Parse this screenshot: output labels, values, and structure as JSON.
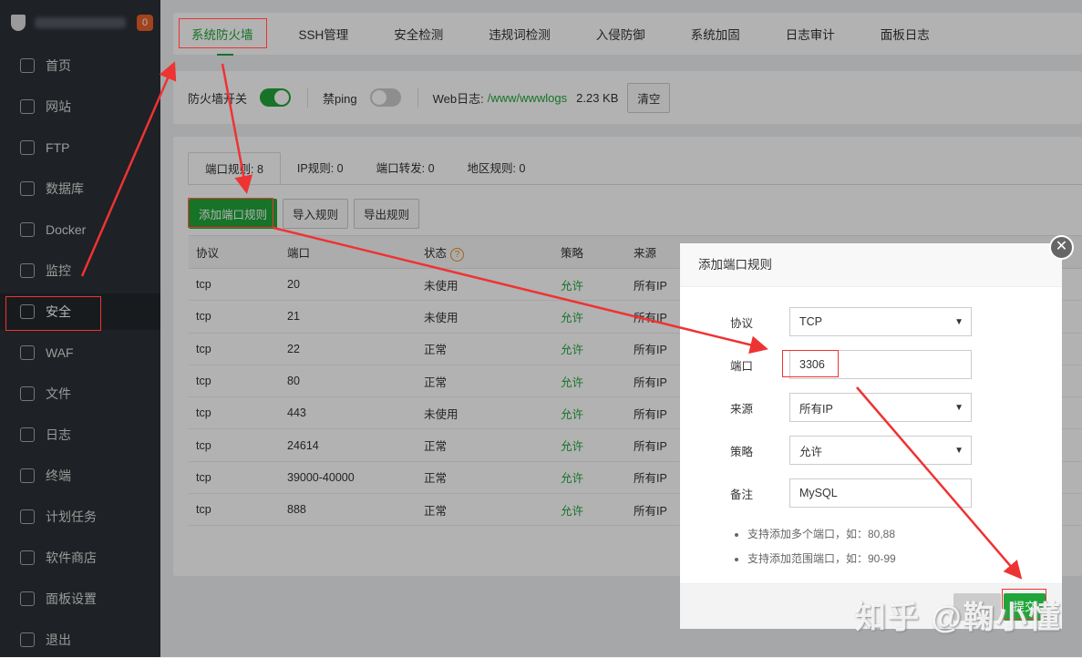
{
  "sidebar": {
    "badge": "0",
    "items": [
      {
        "label": "首页"
      },
      {
        "label": "网站"
      },
      {
        "label": "FTP"
      },
      {
        "label": "数据库"
      },
      {
        "label": "Docker"
      },
      {
        "label": "监控"
      },
      {
        "label": "安全"
      },
      {
        "label": "WAF"
      },
      {
        "label": "文件"
      },
      {
        "label": "日志"
      },
      {
        "label": "终端"
      },
      {
        "label": "计划任务"
      },
      {
        "label": "软件商店"
      },
      {
        "label": "面板设置"
      },
      {
        "label": "退出"
      }
    ]
  },
  "topnav": [
    "系统防火墙",
    "SSH管理",
    "安全检测",
    "违规词检测",
    "入侵防御",
    "系统加固",
    "日志审计",
    "面板日志"
  ],
  "fwbar": {
    "firewall_label": "防火墙开关",
    "ping_label": "禁ping",
    "weblog_label": "Web日志:",
    "weblog_path": "/www/wwwlogs",
    "weblog_size": "2.23 KB",
    "clear": "清空"
  },
  "rule_tabs": [
    "端口规则: 8",
    "IP规则: 0",
    "端口转发: 0",
    "地区规则: 0"
  ],
  "tools": {
    "add": "添加端口规则",
    "import": "导入规则",
    "export": "导出规则"
  },
  "table": {
    "headers": [
      "协议",
      "端口",
      "状态",
      "策略",
      "来源"
    ],
    "rows": [
      [
        "tcp",
        "20",
        "未使用",
        "允许",
        "所有IP"
      ],
      [
        "tcp",
        "21",
        "未使用",
        "允许",
        "所有IP"
      ],
      [
        "tcp",
        "22",
        "正常",
        "允许",
        "所有IP"
      ],
      [
        "tcp",
        "80",
        "正常",
        "允许",
        "所有IP"
      ],
      [
        "tcp",
        "443",
        "未使用",
        "允许",
        "所有IP"
      ],
      [
        "tcp",
        "24614",
        "正常",
        "允许",
        "所有IP"
      ],
      [
        "tcp",
        "39000-40000",
        "正常",
        "允许",
        "所有IP"
      ],
      [
        "tcp",
        "888",
        "正常",
        "允许",
        "所有IP"
      ]
    ]
  },
  "modal": {
    "title": "添加端口规则",
    "fields": [
      {
        "label": "协议",
        "value": "TCP"
      },
      {
        "label": "端口",
        "value": "3306"
      },
      {
        "label": "来源",
        "value": "所有IP"
      },
      {
        "label": "策略",
        "value": "允许"
      },
      {
        "label": "备注",
        "value": "MySQL"
      }
    ],
    "tips": [
      "支持添加多个端口，如：80,88",
      "支持添加范围端口，如：90-99"
    ],
    "submit": "提交"
  },
  "watermark": "知乎 @鞠小懂",
  "colors": {
    "accent": "#20a53a",
    "annotation": "#e33"
  }
}
